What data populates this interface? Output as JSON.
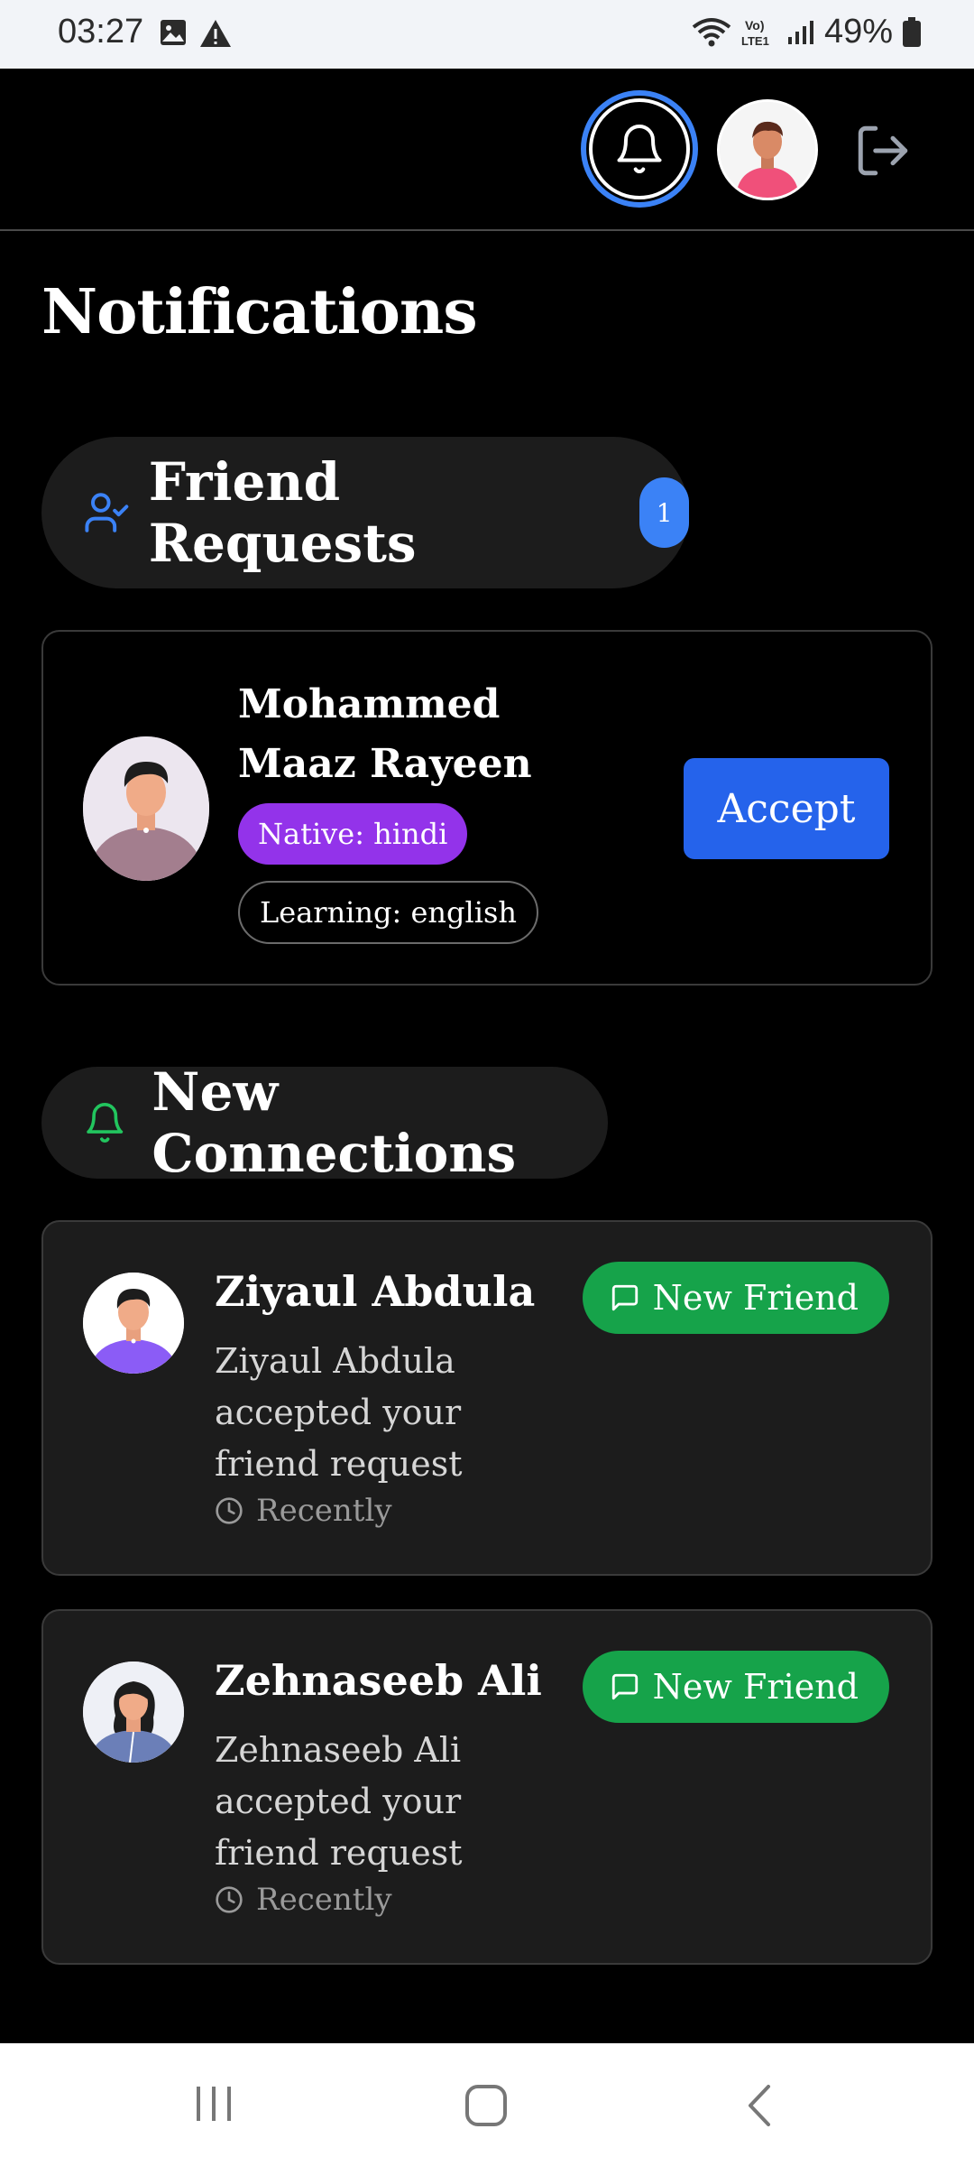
{
  "status_bar": {
    "time": "03:27",
    "battery": "49%"
  },
  "page": {
    "title": "Notifications"
  },
  "friend_requests": {
    "label": "Friend Requests",
    "count": "1",
    "items": [
      {
        "name": "Mohammed Maaz Rayeen",
        "native": "Native: hindi",
        "learning": "Learning: english",
        "accept_label": "Accept"
      }
    ]
  },
  "new_connections": {
    "label": "New Connections",
    "items": [
      {
        "name": "Ziyaul Abdula",
        "message": "Ziyaul Abdula accepted your friend request",
        "time": "Recently",
        "badge": "New Friend"
      },
      {
        "name": "Zehnaseeb Ali",
        "message": "Zehnaseeb Ali accepted your friend request",
        "time": "Recently",
        "badge": "New Friend"
      }
    ]
  },
  "colors": {
    "accent_blue": "#3b82f6",
    "accept_blue": "#2563eb",
    "native_purple": "#9333ea",
    "new_friend_green": "#16a34a"
  },
  "icons": [
    "bell-icon",
    "logout-icon",
    "user-check-icon",
    "message-square-icon",
    "clock-icon"
  ]
}
